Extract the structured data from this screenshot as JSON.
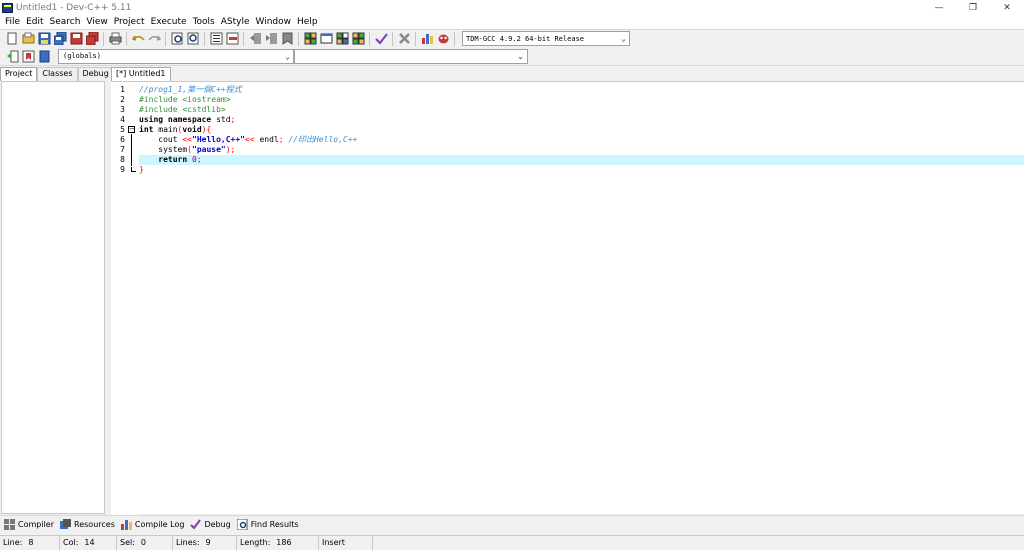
{
  "window": {
    "title": "Untitled1 - Dev-C++ 5.11",
    "controls": {
      "minimize": "—",
      "maximize": "❐",
      "close": "✕"
    }
  },
  "menu": [
    "File",
    "Edit",
    "Search",
    "View",
    "Project",
    "Execute",
    "Tools",
    "AStyle",
    "Window",
    "Help"
  ],
  "toolbar": {
    "compiler": "TDM-GCC 4.9.2 64-bit Release"
  },
  "toolbar2": {
    "scope": "(globals)",
    "function": ""
  },
  "left_panel": {
    "tabs": [
      "Project",
      "Classes",
      "Debug"
    ]
  },
  "editor": {
    "tab_label": "[*] Untitled1",
    "line_numbers": [
      "1",
      "2",
      "3",
      "4",
      "5",
      "6",
      "7",
      "8",
      "9"
    ],
    "current_line": 8
  },
  "bottom_tabs": [
    "Compiler",
    "Resources",
    "Compile Log",
    "Debug",
    "Find Results"
  ],
  "status": {
    "line_label": "Line:",
    "line_value": "8",
    "col_label": "Col:",
    "col_value": "14",
    "sel_label": "Sel:",
    "sel_value": "0",
    "lines_label": "Lines:",
    "lines_value": "9",
    "length_label": "Length:",
    "length_value": "186",
    "mode": "Insert"
  },
  "code": {
    "l1": "//prog1_1,第一個C++程式",
    "l2": "#include <iostream>",
    "l3": "#include <cstdlib>",
    "l4_kw": "using namespace",
    "l4_rest": " std",
    "l4_end": ";",
    "l5_kw": "int",
    "l5_name": " main",
    "l5_p1": "(",
    "l5_void": "void",
    "l5_p2": "){",
    "l6_ind": "    cout ",
    "l6_op1": "<<",
    "l6_str": "\"Hello,C++\"",
    "l6_op2": "<<",
    "l6_endl": " endl",
    "l6_semi": ";",
    "l6_cmt": " //印出Hello,C++",
    "l7_ind": "    system",
    "l7_p1": "(",
    "l7_str": "\"pause\"",
    "l7_p2": ");",
    "l8_ind": "    ",
    "l8_kw": "return",
    "l8_num": " 0",
    "l8_semi": ";",
    "l9": "}"
  }
}
